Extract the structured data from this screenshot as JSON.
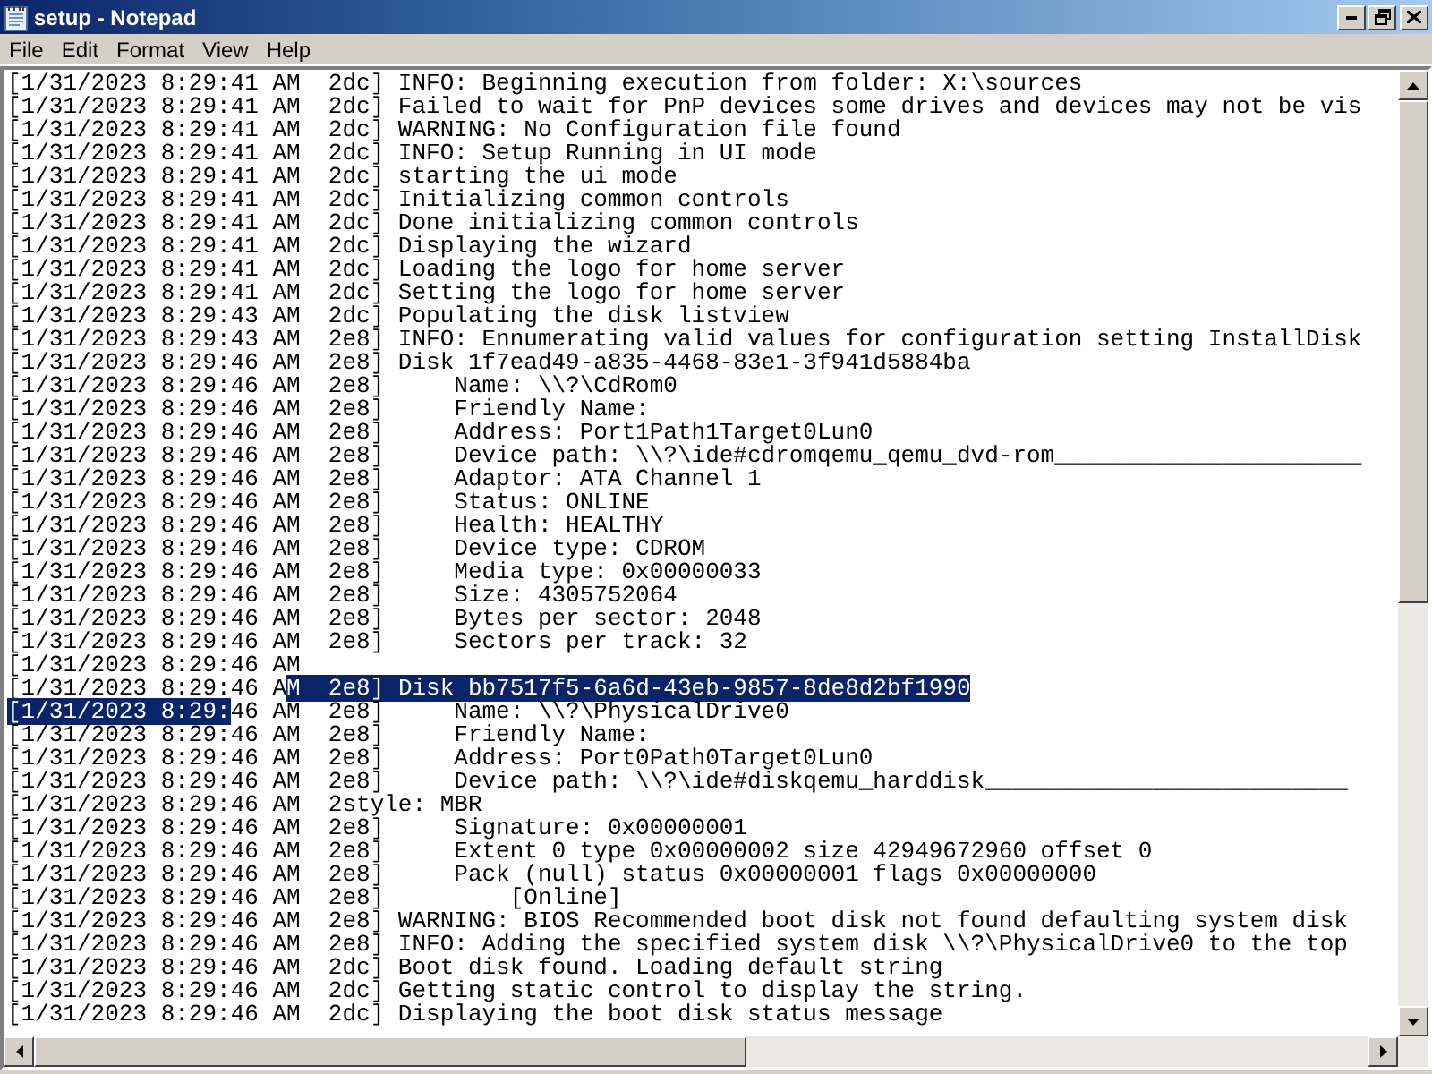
{
  "window": {
    "title": "setup - Notepad"
  },
  "menu": [
    {
      "label": "File"
    },
    {
      "label": "Edit"
    },
    {
      "label": "Format"
    },
    {
      "label": "View"
    },
    {
      "label": "Help"
    }
  ],
  "lines": [
    {
      "segments": [
        {
          "text": "[1/31/2023 8:29:41 AM  2dc] INFO: Beginning execution from folder: X:\\sources",
          "selected": false
        }
      ]
    },
    {
      "segments": [
        {
          "text": "[1/31/2023 8:29:41 AM  2dc] Failed to wait for PnP devices some drives and devices may not be vis",
          "selected": false
        }
      ]
    },
    {
      "segments": [
        {
          "text": "[1/31/2023 8:29:41 AM  2dc] WARNING: No Configuration file found",
          "selected": false
        }
      ]
    },
    {
      "segments": [
        {
          "text": "[1/31/2023 8:29:41 AM  2dc] INFO: Setup Running in UI mode",
          "selected": false
        }
      ]
    },
    {
      "segments": [
        {
          "text": "[1/31/2023 8:29:41 AM  2dc] starting the ui mode",
          "selected": false
        }
      ]
    },
    {
      "segments": [
        {
          "text": "[1/31/2023 8:29:41 AM  2dc] Initializing common controls",
          "selected": false
        }
      ]
    },
    {
      "segments": [
        {
          "text": "[1/31/2023 8:29:41 AM  2dc] Done initializing common controls",
          "selected": false
        }
      ]
    },
    {
      "segments": [
        {
          "text": "[1/31/2023 8:29:41 AM  2dc] Displaying the wizard",
          "selected": false
        }
      ]
    },
    {
      "segments": [
        {
          "text": "[1/31/2023 8:29:41 AM  2dc] Loading the logo for home server",
          "selected": false
        }
      ]
    },
    {
      "segments": [
        {
          "text": "[1/31/2023 8:29:41 AM  2dc] Setting the logo for home server",
          "selected": false
        }
      ]
    },
    {
      "segments": [
        {
          "text": "[1/31/2023 8:29:43 AM  2dc] Populating the disk listview",
          "selected": false
        }
      ]
    },
    {
      "segments": [
        {
          "text": "[1/31/2023 8:29:43 AM  2e8] INFO: Ennumerating valid values for configuration setting InstallDisk",
          "selected": false
        }
      ]
    },
    {
      "segments": [
        {
          "text": "[1/31/2023 8:29:46 AM  2e8] Disk 1f7ead49-a835-4468-83e1-3f941d5884ba",
          "selected": false
        }
      ]
    },
    {
      "segments": [
        {
          "text": "[1/31/2023 8:29:46 AM  2e8]     Name: \\\\?\\CdRom0",
          "selected": false
        }
      ]
    },
    {
      "segments": [
        {
          "text": "[1/31/2023 8:29:46 AM  2e8]     Friendly Name:",
          "selected": false
        }
      ]
    },
    {
      "segments": [
        {
          "text": "[1/31/2023 8:29:46 AM  2e8]     Address: Port1Path1Target0Lun0",
          "selected": false
        }
      ]
    },
    {
      "segments": [
        {
          "text": "[1/31/2023 8:29:46 AM  2e8]     Device path: \\\\?\\ide#cdromqemu_qemu_dvd-rom______________________",
          "selected": false
        }
      ]
    },
    {
      "segments": [
        {
          "text": "[1/31/2023 8:29:46 AM  2e8]     Adaptor: ATA Channel 1",
          "selected": false
        }
      ]
    },
    {
      "segments": [
        {
          "text": "[1/31/2023 8:29:46 AM  2e8]     Status: ONLINE",
          "selected": false
        }
      ]
    },
    {
      "segments": [
        {
          "text": "[1/31/2023 8:29:46 AM  2e8]     Health: HEALTHY",
          "selected": false
        }
      ]
    },
    {
      "segments": [
        {
          "text": "[1/31/2023 8:29:46 AM  2e8]     Device type: CDROM",
          "selected": false
        }
      ]
    },
    {
      "segments": [
        {
          "text": "[1/31/2023 8:29:46 AM  2e8]     Media type: 0x00000033",
          "selected": false
        }
      ]
    },
    {
      "segments": [
        {
          "text": "[1/31/2023 8:29:46 AM  2e8]     Size: 4305752064",
          "selected": false
        }
      ]
    },
    {
      "segments": [
        {
          "text": "[1/31/2023 8:29:46 AM  2e8]     Bytes per sector: 2048",
          "selected": false
        }
      ]
    },
    {
      "segments": [
        {
          "text": "[1/31/2023 8:29:46 AM  2e8]     Sectors per track: 32",
          "selected": false
        }
      ]
    },
    {
      "segments": [
        {
          "text": "[1/31/2023 8:29:46 AM",
          "selected": false
        }
      ]
    },
    {
      "segments": [
        {
          "text": "[1/31/2023 8:29:46 A",
          "selected": false
        },
        {
          "text": "M  2e8] Disk bb7517f5-6a6d-43eb-9857-8de8d2bf1990",
          "selected": true
        }
      ]
    },
    {
      "segments": [
        {
          "text": "[1/31/2023 8:29:",
          "selected": true
        },
        {
          "text": "46 AM  2e8]     Name: \\\\?\\PhysicalDrive0",
          "selected": false
        }
      ]
    },
    {
      "segments": [
        {
          "text": "[1/31/2023 8:29:46 AM  2e8]     Friendly Name:",
          "selected": false
        }
      ]
    },
    {
      "segments": [
        {
          "text": "[1/31/2023 8:29:46 AM  2e8]     Address: Port0Path0Target0Lun0",
          "selected": false
        }
      ]
    },
    {
      "segments": [
        {
          "text": "[1/31/2023 8:29:46 AM  2e8]     Device path: \\\\?\\ide#diskqemu_harddisk__________________________",
          "selected": false
        }
      ]
    },
    {
      "segments": [
        {
          "text": "[1/31/2023 8:29:46 AM  2style: MBR",
          "selected": false
        }
      ]
    },
    {
      "segments": [
        {
          "text": "[1/31/2023 8:29:46 AM  2e8]     Signature: 0x00000001",
          "selected": false
        }
      ]
    },
    {
      "segments": [
        {
          "text": "[1/31/2023 8:29:46 AM  2e8]     Extent 0 type 0x00000002 size 42949672960 offset 0",
          "selected": false
        }
      ]
    },
    {
      "segments": [
        {
          "text": "[1/31/2023 8:29:46 AM  2e8]     Pack (null) status 0x00000001 flags 0x00000000",
          "selected": false
        }
      ]
    },
    {
      "segments": [
        {
          "text": "[1/31/2023 8:29:46 AM  2e8]         [Online]",
          "selected": false
        }
      ]
    },
    {
      "segments": [
        {
          "text": "[1/31/2023 8:29:46 AM  2e8] WARNING: BIOS Recommended boot disk not found defaulting system disk",
          "selected": false
        }
      ]
    },
    {
      "segments": [
        {
          "text": "[1/31/2023 8:29:46 AM  2e8] INFO: Adding the specified system disk \\\\?\\PhysicalDrive0 to the top",
          "selected": false
        }
      ]
    },
    {
      "segments": [
        {
          "text": "[1/31/2023 8:29:46 AM  2dc] Boot disk found. Loading default string",
          "selected": false
        }
      ]
    },
    {
      "segments": [
        {
          "text": "[1/31/2023 8:29:46 AM  2dc] Getting static control to display the string.",
          "selected": false
        }
      ]
    },
    {
      "segments": [
        {
          "text": "[1/31/2023 8:29:46 AM  2dc] Displaying the boot disk status message",
          "selected": false
        }
      ]
    }
  ]
}
